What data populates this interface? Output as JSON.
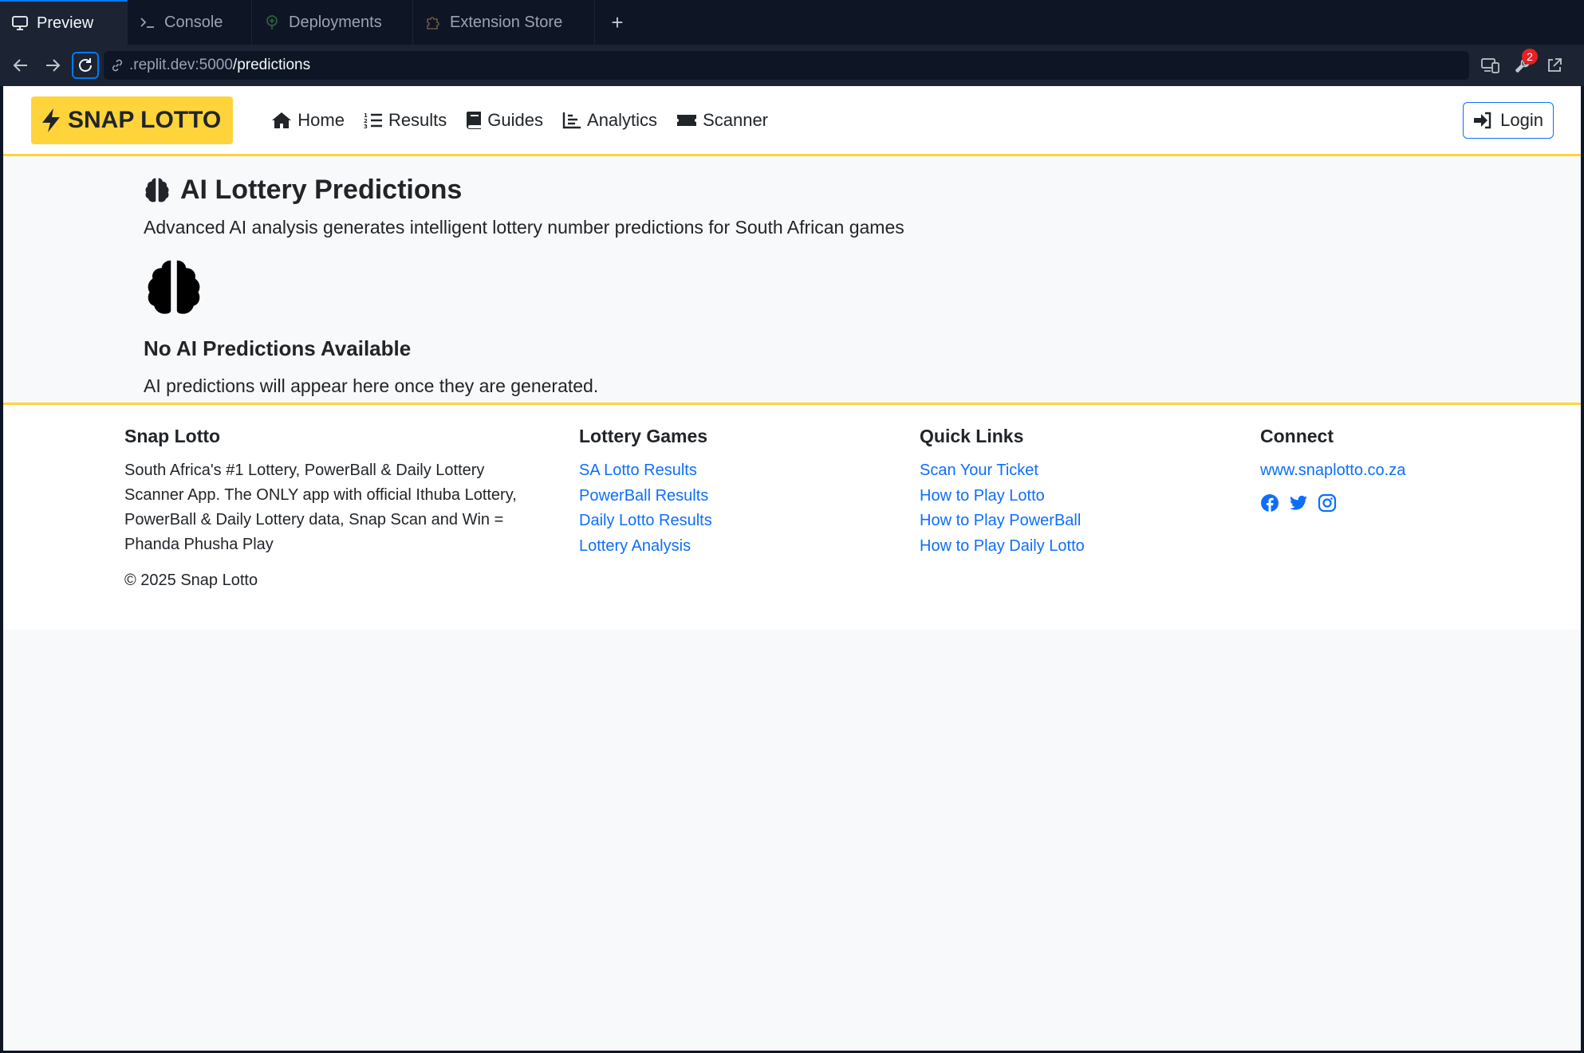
{
  "tabs": [
    {
      "label": "Preview",
      "icon": "monitor-icon"
    },
    {
      "label": "Console",
      "icon": "terminal-icon"
    },
    {
      "label": "Deployments",
      "icon": "deploy-icon"
    },
    {
      "label": "Extension Store",
      "icon": "puzzle-icon"
    }
  ],
  "url": {
    "host": ".replit.dev:5000",
    "path": "/predictions"
  },
  "devtools_badge": "2",
  "navbar": {
    "brand": "SNAP LOTTO",
    "links": [
      {
        "label": "Home",
        "icon": "home-icon"
      },
      {
        "label": "Results",
        "icon": "list-ol-icon"
      },
      {
        "label": "Guides",
        "icon": "book-icon"
      },
      {
        "label": "Analytics",
        "icon": "chart-line-icon"
      },
      {
        "label": "Scanner",
        "icon": "ticket-icon"
      }
    ],
    "login": "Login"
  },
  "main": {
    "title": "AI Lottery Predictions",
    "subtitle": "Advanced AI analysis generates intelligent lottery number predictions for South African games",
    "empty_title": "No AI Predictions Available",
    "empty_text": "AI predictions will appear here once they are generated."
  },
  "footer": {
    "about": {
      "heading": "Snap Lotto",
      "text": "South Africa's #1 Lottery, PowerBall & Daily Lottery Scanner App. The ONLY app with official Ithuba Lottery, PowerBall & Daily Lottery data, Snap Scan and Win = Phanda Phusha Play",
      "copyright": "© 2025 Snap Lotto"
    },
    "games": {
      "heading": "Lottery Games",
      "links": [
        "SA Lotto Results",
        "PowerBall Results",
        "Daily Lotto Results",
        "Lottery Analysis"
      ]
    },
    "quick": {
      "heading": "Quick Links",
      "links": [
        "Scan Your Ticket",
        "How to Play Lotto",
        "How to Play PowerBall",
        "How to Play Daily Lotto"
      ]
    },
    "connect": {
      "heading": "Connect",
      "website": "www.snaplotto.co.za",
      "social": [
        "facebook-icon",
        "twitter-icon",
        "instagram-icon"
      ]
    }
  },
  "colors": {
    "accent": "#ffd43b",
    "link": "#0d6efd",
    "chrome_bg": "#0e1525",
    "chrome_panel": "#1c2333"
  }
}
